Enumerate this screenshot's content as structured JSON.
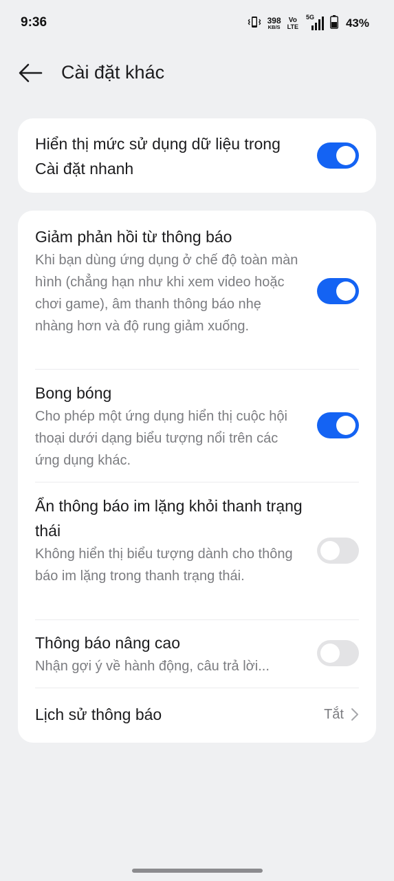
{
  "status_bar": {
    "time": "9:36",
    "net_speed_value": "398",
    "net_speed_unit": "KB/S",
    "volte_top": "Vo",
    "volte_bottom": "LTE",
    "network_type": "5G",
    "battery_percent": "43%",
    "icons": [
      "vibrate-icon",
      "signal-icon",
      "battery-icon"
    ]
  },
  "header": {
    "title": "Cài đặt khác",
    "back_icon": "arrow-left-icon"
  },
  "settings": {
    "data_usage": {
      "title": "Hiển thị mức sử dụng dữ liệu trong Cài đặt nhanh",
      "enabled": true
    },
    "reduce_feedback": {
      "title": "Giảm phản hồi từ thông báo",
      "description": "Khi bạn dùng ứng dụng ở chế độ toàn màn hình (chẳng hạn như khi xem video hoặc chơi game), âm thanh thông báo nhẹ nhàng hơn và độ rung giảm xuống.",
      "enabled": true
    },
    "bubbles": {
      "title": "Bong bóng",
      "description": "Cho phép một ứng dụng hiển thị cuộc hội thoại dưới dạng biểu tượng nổi trên các ứng dụng khác.",
      "enabled": true
    },
    "hide_silent": {
      "title": "Ẩn thông báo im lặng khỏi thanh trạng thái",
      "description": "Không hiển thị biểu tượng dành cho thông báo im lặng trong thanh trạng thái.",
      "enabled": false
    },
    "enhanced": {
      "title": "Thông báo nâng cao",
      "description": "Nhận gợi ý về hành động, câu trả lời...",
      "enabled": false
    },
    "history": {
      "title": "Lịch sử thông báo",
      "value": "Tắt",
      "chevron_icon": "chevron-right-icon"
    }
  },
  "colors": {
    "accent": "#1463f3",
    "background": "#eff0f2",
    "card": "#ffffff",
    "secondary_text": "#7b7c80"
  }
}
